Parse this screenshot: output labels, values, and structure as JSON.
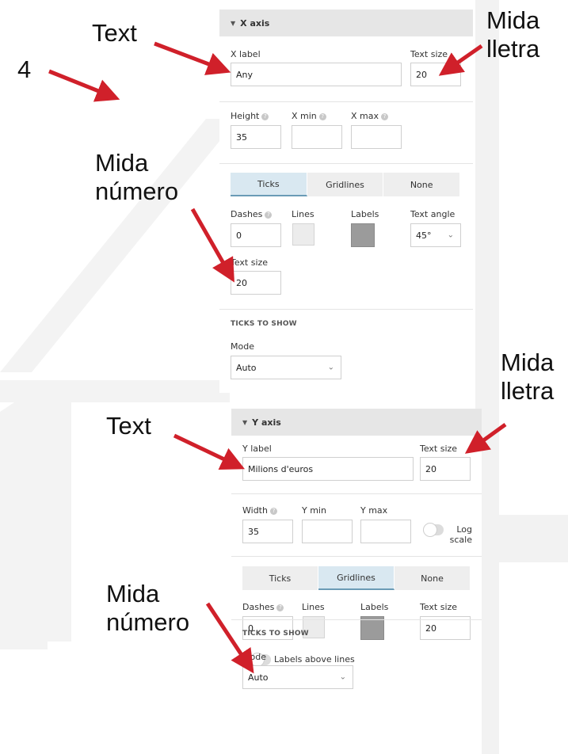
{
  "x_axis": {
    "title": "X axis",
    "label_caption": "X label",
    "label_value": "Any",
    "text_size_caption": "Text size",
    "text_size_value": "20",
    "height_caption": "Height",
    "height_value": "35",
    "xmin_caption": "X min",
    "xmin_value": "",
    "xmax_caption": "X max",
    "xmax_value": "",
    "tabs": [
      "Ticks",
      "Gridlines",
      "None"
    ],
    "active_tab": "Ticks",
    "dashes_caption": "Dashes",
    "dashes_value": "0",
    "lines_caption": "Lines",
    "labels_caption": "Labels",
    "text_angle_caption": "Text angle",
    "text_angle_value": "45°",
    "tick_text_size_caption": "Text size",
    "tick_text_size_value": "20",
    "ticks_to_show": "TICKS TO SHOW",
    "mode_caption": "Mode",
    "mode_value": "Auto"
  },
  "y_axis": {
    "title": "Y axis",
    "label_caption": "Y label",
    "label_value": "Milions d'euros",
    "text_size_caption": "Text size",
    "text_size_value": "20",
    "width_caption": "Width",
    "width_value": "35",
    "ymin_caption": "Y min",
    "ymin_value": "",
    "ymax_caption": "Y max",
    "ymax_value": "",
    "log_scale_caption": "Log scale",
    "tabs": [
      "Ticks",
      "Gridlines",
      "None"
    ],
    "active_tab": "Gridlines",
    "dashes_caption": "Dashes",
    "dashes_value": "0",
    "lines_caption": "Lines",
    "labels_caption": "Labels",
    "tick_text_size_caption": "Text size",
    "tick_text_size_value": "20",
    "labels_above_lines_caption": "Labels above lines",
    "ticks_to_show": "TICKS TO SHOW",
    "mode_caption": "Mode",
    "mode_value": "Auto"
  },
  "annotations": {
    "number": "4",
    "text_top": "Text",
    "mida_lletra_top": "Mida lletra",
    "mida_numero_top": "Mida número",
    "mida_lletra_bottom": "Mida lletra",
    "text_bottom": "Text",
    "mida_numero_bottom": "Mida número"
  },
  "colors": {
    "arrow": "#d0202a",
    "active_tab": "#d9e8f1",
    "active_tab_border": "#6a9bb6",
    "panel_header": "#e6e6e6"
  }
}
